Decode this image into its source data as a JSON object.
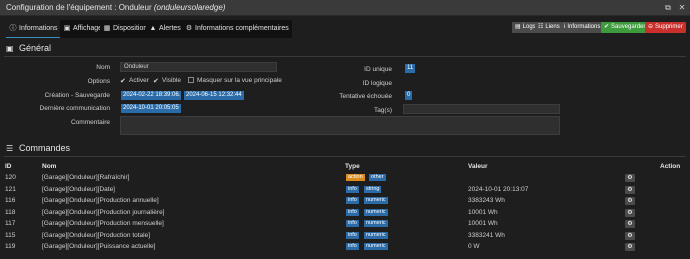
{
  "window": {
    "title_prefix": "Configuration de l'équipement : Onduleur ",
    "title_italic": "(onduleursolaredge)",
    "fullscreen_icon": "fullscreen-icon",
    "close_icon": "close-icon"
  },
  "tabs": [
    {
      "label": "Informations",
      "icon": "info-circle-icon"
    },
    {
      "label": "Affichage",
      "icon": "monitor-icon"
    },
    {
      "label": "Disposition",
      "icon": "grid-icon"
    },
    {
      "label": "Alertes",
      "icon": "warning-icon"
    },
    {
      "label": "Informations complémentaires",
      "icon": "gears-icon"
    }
  ],
  "actions": {
    "logs": "Logs",
    "liens": "Liens",
    "informations": "Informations",
    "sauvegarder": "Sauvegarder",
    "supprimer": "Supprimer"
  },
  "general": {
    "title": "Général",
    "nom_label": "Nom",
    "nom_value": "Onduleur",
    "options_label": "Options",
    "activer": "Activer",
    "visible": "Visible",
    "masquer": "Masquer sur la vue principale",
    "creation_label": "Création - Sauvegarde",
    "creation_date": "2024-02-22 18:39:06",
    "dash": "-",
    "sauvegarde_date": "2024-06-15 12:32:44",
    "derniere_label": "Dernière communication",
    "derniere_value": "2024-10-01 20:05:05",
    "commentaire_label": "Commentaire",
    "id_unique_label": "ID unique",
    "id_unique_value": "11",
    "id_logique_label": "ID logique",
    "tentative_label": "Tentative échouée",
    "tentative_value": "0",
    "tags_label": "Tag(s)"
  },
  "commandes": {
    "title": "Commandes",
    "headers": {
      "id": "ID",
      "nom": "Nom",
      "type": "Type",
      "valeur": "Valeur",
      "action": "Action"
    },
    "rows": [
      {
        "id": "120",
        "nom": "[Garage][Onduleur][Rafraîchir]",
        "type1": "action",
        "type2": "other",
        "valeur": ""
      },
      {
        "id": "121",
        "nom": "[Garage][Onduleur][Date]",
        "type1": "info",
        "type2": "string",
        "valeur": "2024-10-01 20:13:07"
      },
      {
        "id": "116",
        "nom": "[Garage][Onduleur][Production annuelle]",
        "type1": "info",
        "type2": "numeric",
        "valeur": "3383243 Wh"
      },
      {
        "id": "118",
        "nom": "[Garage][Onduleur][Production journalière]",
        "type1": "info",
        "type2": "numeric",
        "valeur": "10001 Wh"
      },
      {
        "id": "117",
        "nom": "[Garage][Onduleur][Production mensuelle]",
        "type1": "info",
        "type2": "numeric",
        "valeur": "10001 Wh"
      },
      {
        "id": "115",
        "nom": "[Garage][Onduleur][Production totale]",
        "type1": "info",
        "type2": "numeric",
        "valeur": "3383241 Wh"
      },
      {
        "id": "119",
        "nom": "[Garage][Onduleur][Puissance actuelle]",
        "type1": "info",
        "type2": "numeric",
        "valeur": "0 W"
      }
    ]
  }
}
